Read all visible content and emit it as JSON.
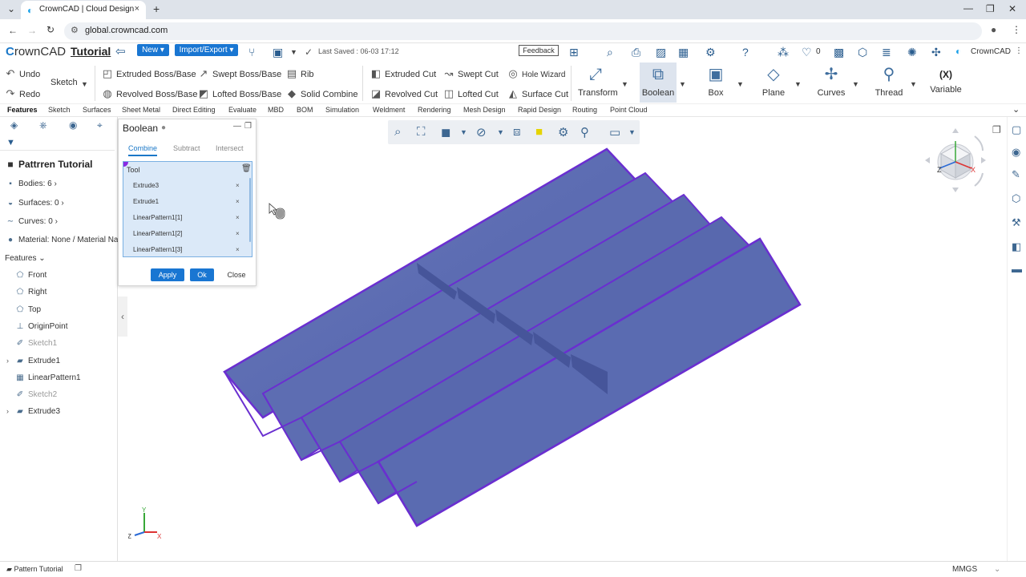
{
  "browser": {
    "tab_title": "CrownCAD | Cloud Design",
    "url": "global.crowncad.com",
    "new_tab": "+",
    "close_tab": "×",
    "menu_caret": "⌄",
    "back": "←",
    "forward": "→",
    "reload": "↻",
    "minimize": "—",
    "restore": "❐",
    "close": "✕",
    "more": "⋮"
  },
  "app": {
    "logo_prefix": "C",
    "logo_rest": "rownCAD",
    "project": "Tutorial",
    "new_label": "New",
    "import_export_label": "Import/Export",
    "saved_text": "Last Saved : 06-03 17:12",
    "feedback_label": "Feedback",
    "likes": "0",
    "user_name": "CrownCAD"
  },
  "ribbon": {
    "undo": "Undo",
    "redo": "Redo",
    "sketch": "Sketch",
    "extruded_boss": "Extruded Boss/Base",
    "revolved_boss": "Revolved Boss/Base",
    "swept_boss": "Swept Boss/Base",
    "lofted_boss": "Lofted Boss/Base",
    "rib": "Rib",
    "solid_combine": "Solid Combine",
    "extruded_cut": "Extruded Cut",
    "revolved_cut": "Revolved Cut",
    "swept_cut": "Swept Cut",
    "lofted_cut": "Lofted Cut",
    "hole_wizard": "Hole Wizard",
    "surface_cut": "Surface Cut",
    "transform": "Transform",
    "boolean": "Boolean",
    "box": "Box",
    "plane": "Plane",
    "curves": "Curves",
    "thread": "Thread",
    "variable_icon": "(X)",
    "variable": "Variable"
  },
  "feature_tabs": [
    "Features",
    "Sketch",
    "Surfaces",
    "Sheet Metal",
    "Direct Editing",
    "Evaluate",
    "MBD",
    "BOM",
    "Simulation",
    "Weldment",
    "Rendering",
    "Mesh Design",
    "Rapid Design",
    "Routing",
    "Point Cloud"
  ],
  "left_panel": {
    "title": "Pattrren Tutorial",
    "bodies": "Bodies: 6",
    "surfaces": "Surfaces: 0",
    "curves": "Curves: 0",
    "material": "Material: None / Material Na",
    "features_label": "Features",
    "tree": [
      {
        "label": "Front",
        "icon": "plane-icon",
        "grey": false,
        "expand": false
      },
      {
        "label": "Right",
        "icon": "plane-icon",
        "grey": false,
        "expand": false
      },
      {
        "label": "Top",
        "icon": "plane-icon",
        "grey": false,
        "expand": false
      },
      {
        "label": "OriginPoint",
        "icon": "origin-icon",
        "grey": false,
        "expand": false
      },
      {
        "label": "Sketch1",
        "icon": "sketch-icon",
        "grey": true,
        "expand": false
      },
      {
        "label": "Extrude1",
        "icon": "extrude-icon",
        "grey": false,
        "expand": true
      },
      {
        "label": "LinearPattern1",
        "icon": "pattern-icon",
        "grey": false,
        "expand": false
      },
      {
        "label": "Sketch2",
        "icon": "sketch-icon",
        "grey": true,
        "expand": false
      },
      {
        "label": "Extrude3",
        "icon": "extrude-icon",
        "grey": false,
        "expand": true
      }
    ]
  },
  "dialog": {
    "title": "Boolean",
    "tabs": [
      "Combine",
      "Subtract",
      "Intersect"
    ],
    "tool_label": "Tool",
    "tools": [
      "Extrude3",
      "Extrude1",
      "LinearPattern1[1]",
      "LinearPattern1[2]",
      "LinearPattern1[3]"
    ],
    "remove_glyph": "×",
    "apply": "Apply",
    "ok": "Ok",
    "close": "Close"
  },
  "viewcube": {
    "x": "X",
    "y": "Y",
    "z": "Z"
  },
  "triad": {
    "x": "X",
    "y": "Y",
    "z": "Z"
  },
  "status": {
    "tab": "Pattern Tutorial",
    "units": "MMGS"
  },
  "colors": {
    "accent": "#1976d2",
    "model_fill": "#5b6cb2",
    "model_edge": "#6a2fd0"
  }
}
